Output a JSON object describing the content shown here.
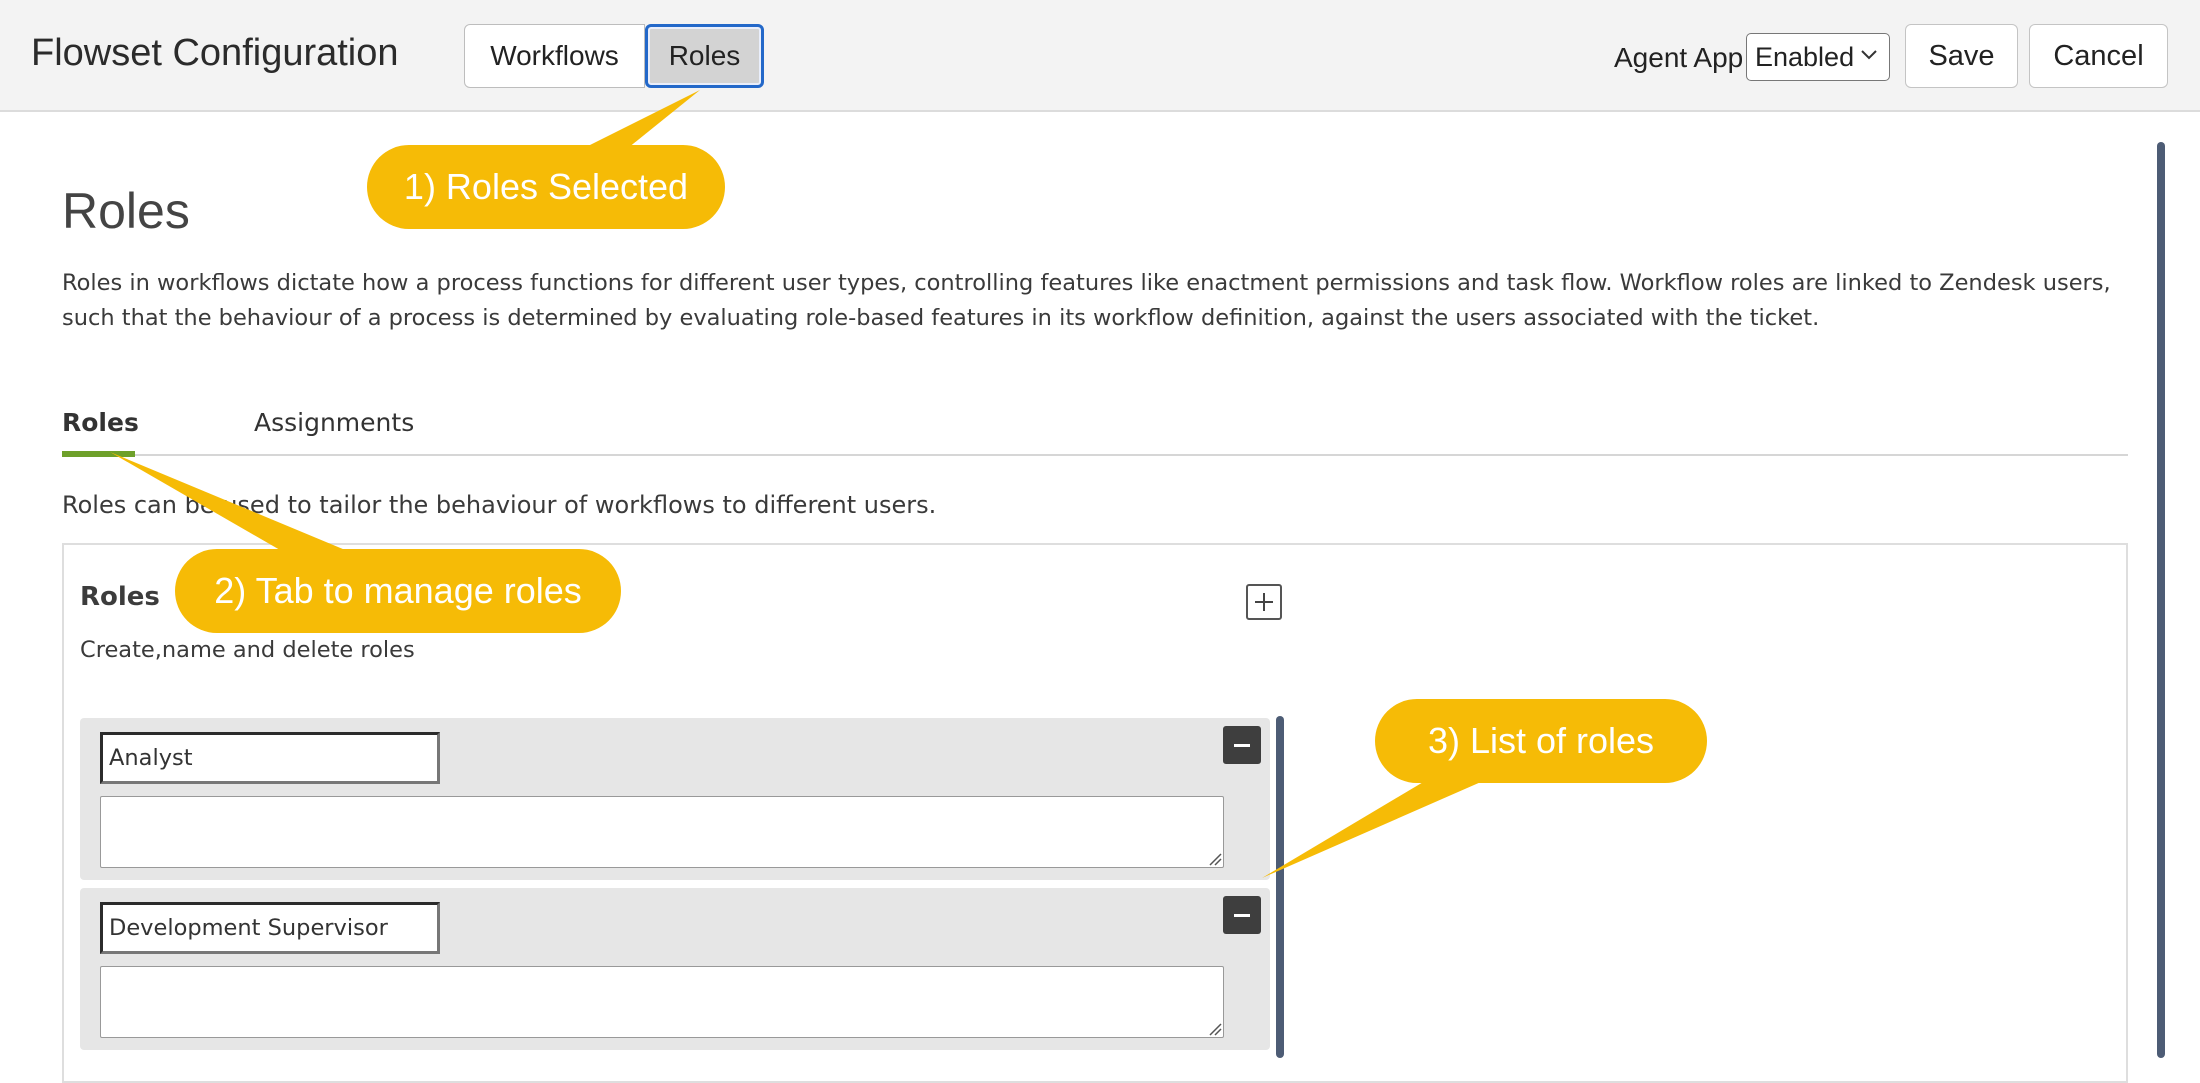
{
  "header": {
    "title": "Flowset Configuration",
    "tabs": [
      {
        "label": "Workflows",
        "selected": false
      },
      {
        "label": "Roles",
        "selected": true
      }
    ],
    "agent_app_label": "Agent App",
    "agent_app_value": "Enabled",
    "save_label": "Save",
    "cancel_label": "Cancel"
  },
  "page": {
    "title": "Roles",
    "description": "Roles in workflows dictate how a process functions for different user types, controlling features like enactment permissions and task flow. Workflow roles are linked to Zendesk users, such that the behaviour of a process is determined by evaluating role-based features in its workflow definition, against the users associated with the ticket."
  },
  "subtabs": [
    {
      "label": "Roles",
      "active": true
    },
    {
      "label": "Assignments",
      "active": false
    }
  ],
  "roles_tab": {
    "help_text": "Roles can be used to tailor the behaviour of workflows to different users.",
    "panel_title": "Roles",
    "panel_subtitle": "Create,name and delete roles",
    "roles": [
      {
        "name": "Analyst",
        "description": ""
      },
      {
        "name": "Development Supervisor",
        "description": ""
      }
    ]
  },
  "callouts": [
    {
      "text": "1) Roles Selected"
    },
    {
      "text": "2) Tab to manage roles"
    },
    {
      "text": "3) List of roles"
    }
  ],
  "colors": {
    "callout": "#f6bb06",
    "selected_border": "#2368c9",
    "tab_underline": "#6ea02a",
    "scrollbar": "#4d5c75"
  }
}
